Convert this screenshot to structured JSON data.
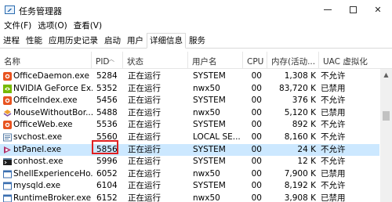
{
  "window": {
    "title": "任务管理器"
  },
  "menu": [
    "文件(F)",
    "选项(O)",
    "查看(V)"
  ],
  "tabs": [
    {
      "label": "进程",
      "active": false
    },
    {
      "label": "性能",
      "active": false
    },
    {
      "label": "应用历史记录",
      "active": false
    },
    {
      "label": "启动",
      "active": false
    },
    {
      "label": "用户",
      "active": false
    },
    {
      "label": "详细信息",
      "active": true
    },
    {
      "label": "服务",
      "active": false
    }
  ],
  "columns": {
    "name": "名称",
    "pid": "PID",
    "status": "状态",
    "user": "用户名",
    "cpu": "CPU",
    "memory": "内存(活动...",
    "uac": "UAC 虚拟化"
  },
  "rows": [
    {
      "icon": "office-icon",
      "name": "OfficeDaemon.exe",
      "pid": "5284",
      "status": "正在运行",
      "user": "SYSTEM",
      "cpu": "00",
      "memory": "1,308 K",
      "uac": "不允许"
    },
    {
      "icon": "nvidia-icon",
      "name": "NVIDIA GeForce Ex...",
      "pid": "5352",
      "status": "正在运行",
      "user": "nwx50",
      "cpu": "00",
      "memory": "83,720 K",
      "uac": "已禁用"
    },
    {
      "icon": "office-icon",
      "name": "OfficeIndex.exe",
      "pid": "5456",
      "status": "正在运行",
      "user": "SYSTEM",
      "cpu": "00",
      "memory": "376 K",
      "uac": "不允许"
    },
    {
      "icon": "mouse-icon",
      "name": "MouseWithoutBor...",
      "pid": "5488",
      "status": "正在运行",
      "user": "nwx50",
      "cpu": "00",
      "memory": "5,120 K",
      "uac": "已禁用"
    },
    {
      "icon": "office-icon",
      "name": "OfficeWeb.exe",
      "pid": "5536",
      "status": "正在运行",
      "user": "SYSTEM",
      "cpu": "00",
      "memory": "892 K",
      "uac": "不允许"
    },
    {
      "icon": "service-icon",
      "name": "svchost.exe",
      "pid": "5560",
      "status": "正在运行",
      "user": "LOCAL SE...",
      "cpu": "00",
      "memory": "8,160 K",
      "uac": "不允许"
    },
    {
      "icon": "btpanel-icon",
      "name": "btPanel.exe",
      "pid": "5856",
      "status": "正在运行",
      "user": "SYSTEM",
      "cpu": "00",
      "memory": "24 K",
      "uac": "不允许",
      "selected": true
    },
    {
      "icon": "console-icon",
      "name": "conhost.exe",
      "pid": "5996",
      "status": "正在运行",
      "user": "SYSTEM",
      "cpu": "00",
      "memory": "12 K",
      "uac": "不允许"
    },
    {
      "icon": "window-icon",
      "name": "ShellExperienceHo...",
      "pid": "6052",
      "status": "正在运行",
      "user": "nwx50",
      "cpu": "00",
      "memory": "7,900 K",
      "uac": "已禁用"
    },
    {
      "icon": "window-icon",
      "name": "mysqld.exe",
      "pid": "6104",
      "status": "正在运行",
      "user": "SYSTEM",
      "cpu": "00",
      "memory": "8,192 K",
      "uac": "不允许"
    },
    {
      "icon": "window-icon",
      "name": "RuntimeBroker.exe",
      "pid": "6152",
      "status": "正在运行",
      "user": "nwx50",
      "cpu": "00",
      "memory": "3,908 K",
      "uac": "已禁用"
    }
  ],
  "colors": {
    "selection": "#cce8ff",
    "highlight_box": "#e02020",
    "accent": "#2b6cb0"
  }
}
